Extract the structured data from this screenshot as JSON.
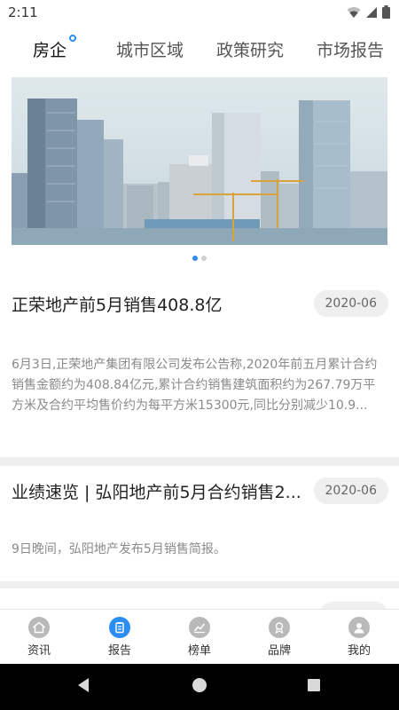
{
  "status_bar": {
    "time": "2:11"
  },
  "top_tabs": [
    {
      "label": "房企",
      "active": true
    },
    {
      "label": "城市区域",
      "active": false
    },
    {
      "label": "政策研究",
      "active": false
    },
    {
      "label": "市场报告",
      "active": false
    }
  ],
  "banner": {
    "image": "city-skyline-buildings",
    "pages": 2,
    "current_page": 1
  },
  "articles": [
    {
      "title": "正荣地产前5月销售408.8亿",
      "date": "2020-06",
      "summary": "6月3日,正荣地产集团有限公司发布公告称,2020年前五月累计合约销售金额约为408.84亿元,累计合约销售建筑面积约为267.79万平方米及合约平均售价约为每平方米15300元,同比分别减少10.9..."
    },
    {
      "title": "业绩速览 | 弘阳地产前5月合约销售2...",
      "date": "2020-06",
      "summary": "9日晚间，弘阳地产发布5月销售简报。"
    }
  ],
  "bottom_nav": [
    {
      "label": "资讯",
      "icon": "home-icon",
      "active": false
    },
    {
      "label": "报告",
      "icon": "report-icon",
      "active": true
    },
    {
      "label": "榜单",
      "icon": "chart-icon",
      "active": false
    },
    {
      "label": "品牌",
      "icon": "brand-icon",
      "active": false
    },
    {
      "label": "我的",
      "icon": "user-icon",
      "active": false
    }
  ],
  "colors": {
    "accent": "#2c8ef2",
    "inactive_icon": "#b9b9b9",
    "background": "#efefef",
    "date_pill": "#efefef"
  }
}
